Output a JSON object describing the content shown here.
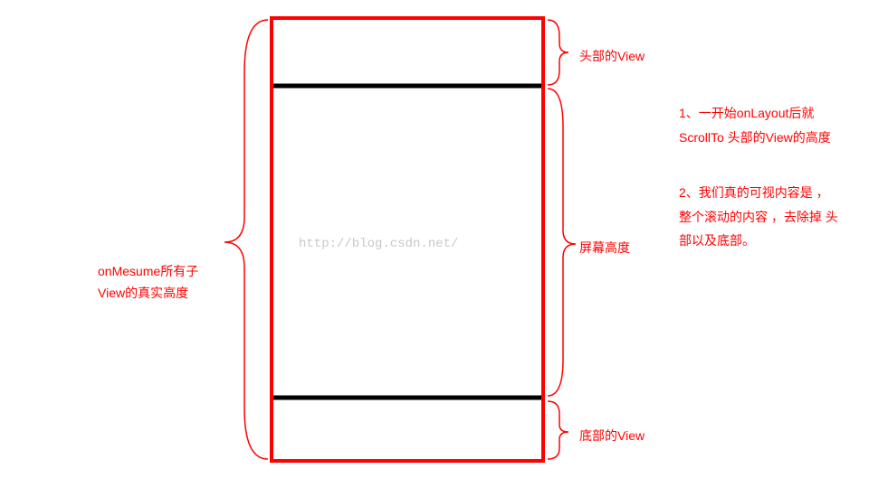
{
  "labels": {
    "header_view": "头部的View",
    "screen_height": "屏幕高度",
    "footer_view": "底部的View",
    "measure_line1": "onMesume所有子",
    "measure_line2": "View的真实高度"
  },
  "notes": {
    "note1": "1、一开始onLayout后就 ScrollTo   头部的View的高度",
    "note2": "2、我们真的可视内容是 ， 整个滚动的内容 ，去除掉 头部以及底部。"
  },
  "watermark": "http://blog.csdn.net/",
  "colors": {
    "red": "#ff0000",
    "black": "#000000",
    "gray": "#c8c8c8"
  }
}
